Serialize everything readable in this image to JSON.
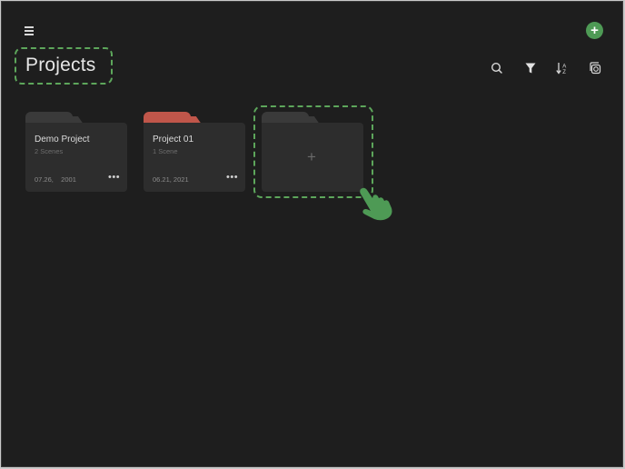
{
  "header": {
    "title": "Projects",
    "add_label": "+"
  },
  "toolbar": {
    "icons": [
      "search-icon",
      "filter-icon",
      "sort-az-icon",
      "select-icon"
    ]
  },
  "projects": [
    {
      "name": "Demo Project",
      "scenes": "2 Scenes",
      "date": "07.26,    2001",
      "more": "•••",
      "tab_color": "#3a3a3a"
    },
    {
      "name": "Project 01",
      "scenes": "1 Scene",
      "date": "06.21, 2021",
      "more": "•••",
      "tab_color": "#c0564a"
    }
  ],
  "new_project": {
    "label": "+"
  },
  "colors": {
    "accent": "#4e9a55",
    "highlight": "#5da65b",
    "background": "#1e1e1e",
    "card": "#2d2d2d"
  }
}
